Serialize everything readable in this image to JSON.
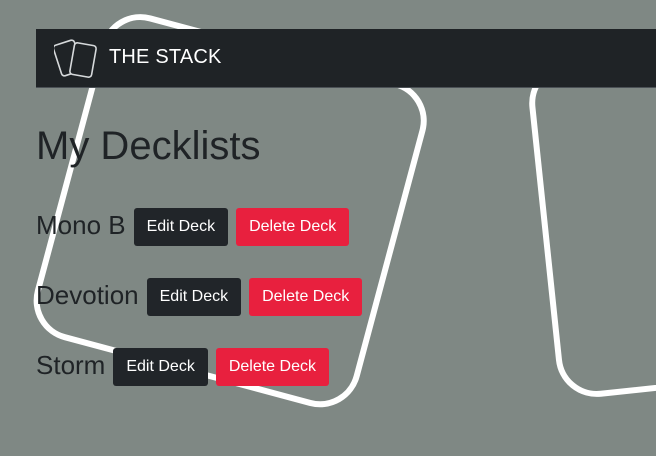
{
  "navbar": {
    "brand_title": "THE STACK",
    "logo_icon": "card-stack-icon"
  },
  "main": {
    "title": "My Decklists",
    "decks": [
      {
        "name": "Mono B",
        "edit_label": "Edit Deck",
        "delete_label": "Delete Deck"
      },
      {
        "name": "Devotion",
        "edit_label": "Edit Deck",
        "delete_label": "Delete Deck"
      },
      {
        "name": "Storm",
        "edit_label": "Edit Deck",
        "delete_label": "Delete Deck"
      }
    ]
  },
  "colors": {
    "background": "#7f8884",
    "navbar": "#1f2326",
    "edit_button": "#212529",
    "delete_button": "#e8203e",
    "text": "#1f2326"
  }
}
